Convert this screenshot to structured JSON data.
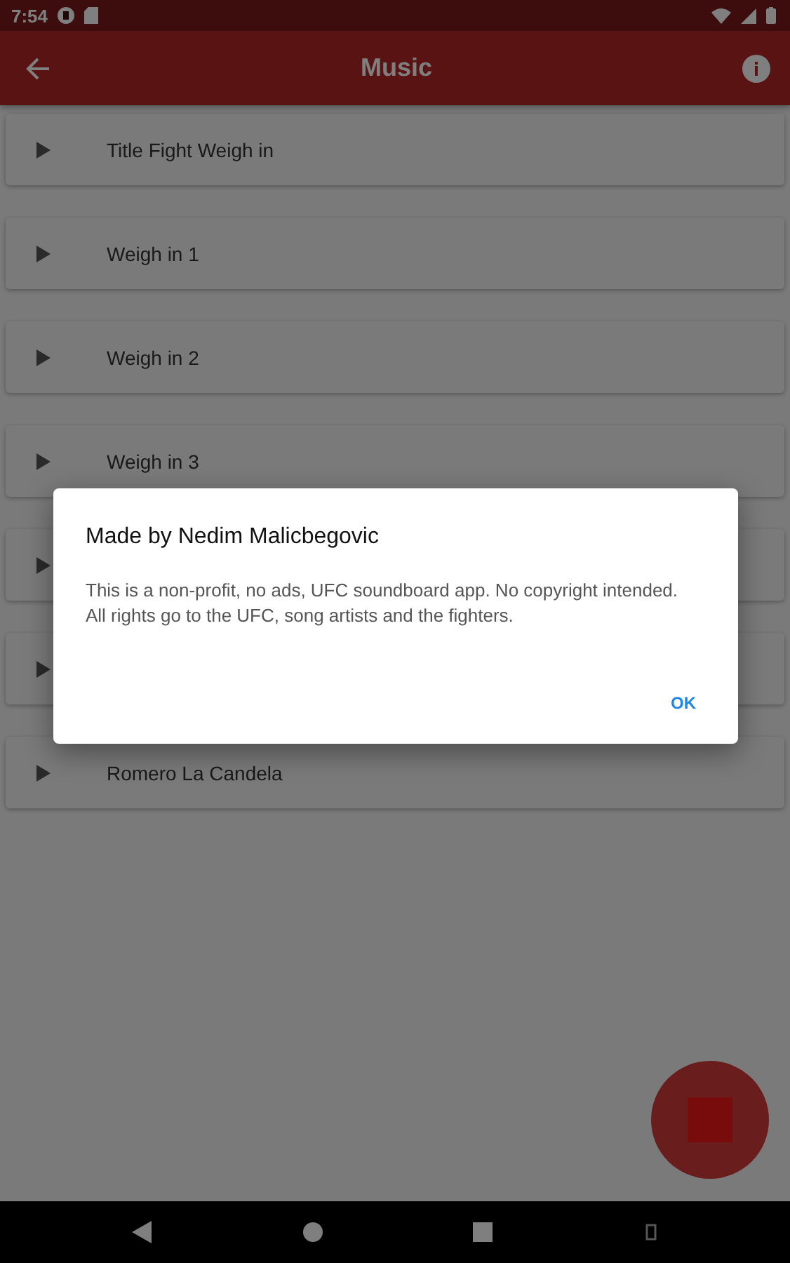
{
  "status_bar": {
    "time": "7:54"
  },
  "app_bar": {
    "title": "Music"
  },
  "tracks": [
    {
      "kind": "track",
      "title": "Title Fight Weigh in"
    },
    {
      "kind": "track",
      "title": "Weigh in 1"
    },
    {
      "kind": "track",
      "title": "Weigh in 2"
    },
    {
      "kind": "track",
      "title": "Weigh in 3"
    },
    {
      "kind": "covered"
    },
    {
      "kind": "covered"
    },
    {
      "kind": "track",
      "title": "Romero La Candela"
    }
  ],
  "dialog": {
    "title": "Made by Nedim Malicbegovic",
    "message": "This is a non-profit, no ads, UFC soundboard app. No copyright intended. All rights go to the UFC, song artists and the fighters.",
    "button": "OK"
  }
}
